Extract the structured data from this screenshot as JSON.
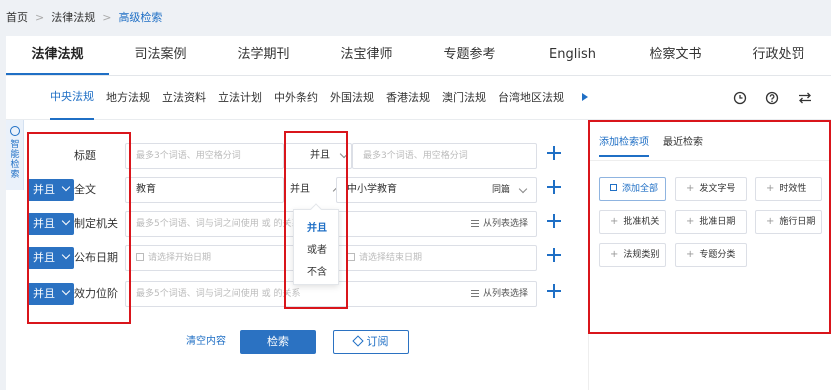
{
  "breadcrumb": {
    "home": "首页",
    "level1": "法律法规",
    "current": "高级检索"
  },
  "main_tabs": [
    "法律法规",
    "司法案例",
    "法学期刊",
    "法宝律师",
    "专题参考",
    "English",
    "检察文书",
    "行政处罚"
  ],
  "sub_tabs": [
    "中央法规",
    "地方法规",
    "立法资料",
    "立法计划",
    "中外条约",
    "外国法规",
    "香港法规",
    "澳门法规",
    "台湾地区法规"
  ],
  "toolbar": {
    "history_icon": "clock-icon",
    "help_icon": "question-icon",
    "switch_icon": "swap-arrows-icon"
  },
  "side_tab": {
    "label": "智能检索"
  },
  "rows": [
    {
      "op": "",
      "label": "标题",
      "placeholder_left": "最多3个词语、用空格分词",
      "mid_op": "并且",
      "placeholder_right": "最多3个词语、用空格分词"
    },
    {
      "op": "并且",
      "label": "全文",
      "value_left": "教育",
      "mid_op": "并且",
      "value_right": "中小学教育",
      "scope": "同篇"
    },
    {
      "op": "并且",
      "label": "制定机关",
      "placeholder_left": "最多5个词语、词与词之间使用 或 的关系",
      "list_pick": "从列表选择"
    },
    {
      "op": "并且",
      "label": "公布日期",
      "placeholder_start": "请选择开始日期",
      "placeholder_end": "请选择结束日期"
    },
    {
      "op": "并且",
      "label": "效力位阶",
      "placeholder_left": "最多5个词语、词与词之间使用 或 的关系",
      "list_pick": "从列表选择"
    }
  ],
  "dropdown_options": [
    "并且",
    "或者",
    "不含"
  ],
  "dropdown_selected": "并且",
  "actions": {
    "clear": "清空内容",
    "search": "检索",
    "subscribe": "订阅"
  },
  "panel": {
    "tabs": [
      "添加检索项",
      "最近检索"
    ],
    "chips": [
      "添加全部",
      "发文字号",
      "时效性",
      "批准机关",
      "批准日期",
      "施行日期",
      "法规类别",
      "专题分类"
    ]
  },
  "colors": {
    "accent": "#1f6fc5",
    "highlight_box": "#d9151b"
  }
}
